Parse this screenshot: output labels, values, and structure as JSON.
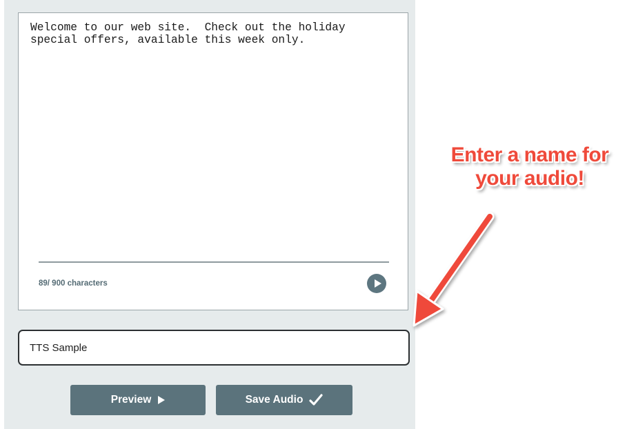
{
  "editor": {
    "text": "Welcome to our web site.  Check out the holiday\nspecial offers, available this week only.",
    "char_count": "89/ 900 characters",
    "play_icon": "play-circle-icon"
  },
  "name_field": {
    "value": "TTS Sample"
  },
  "buttons": {
    "preview_label": "Preview",
    "preview_icon": "play-icon",
    "save_label": "Save Audio",
    "save_icon": "checkmark-icon"
  },
  "annotation": {
    "line1": "Enter a name for",
    "line2": "your audio!",
    "color": "#ef4a3b"
  },
  "colors": {
    "panel_bg": "#e6ebec",
    "button_bg": "#5b737c",
    "accent_text": "#546b74"
  }
}
